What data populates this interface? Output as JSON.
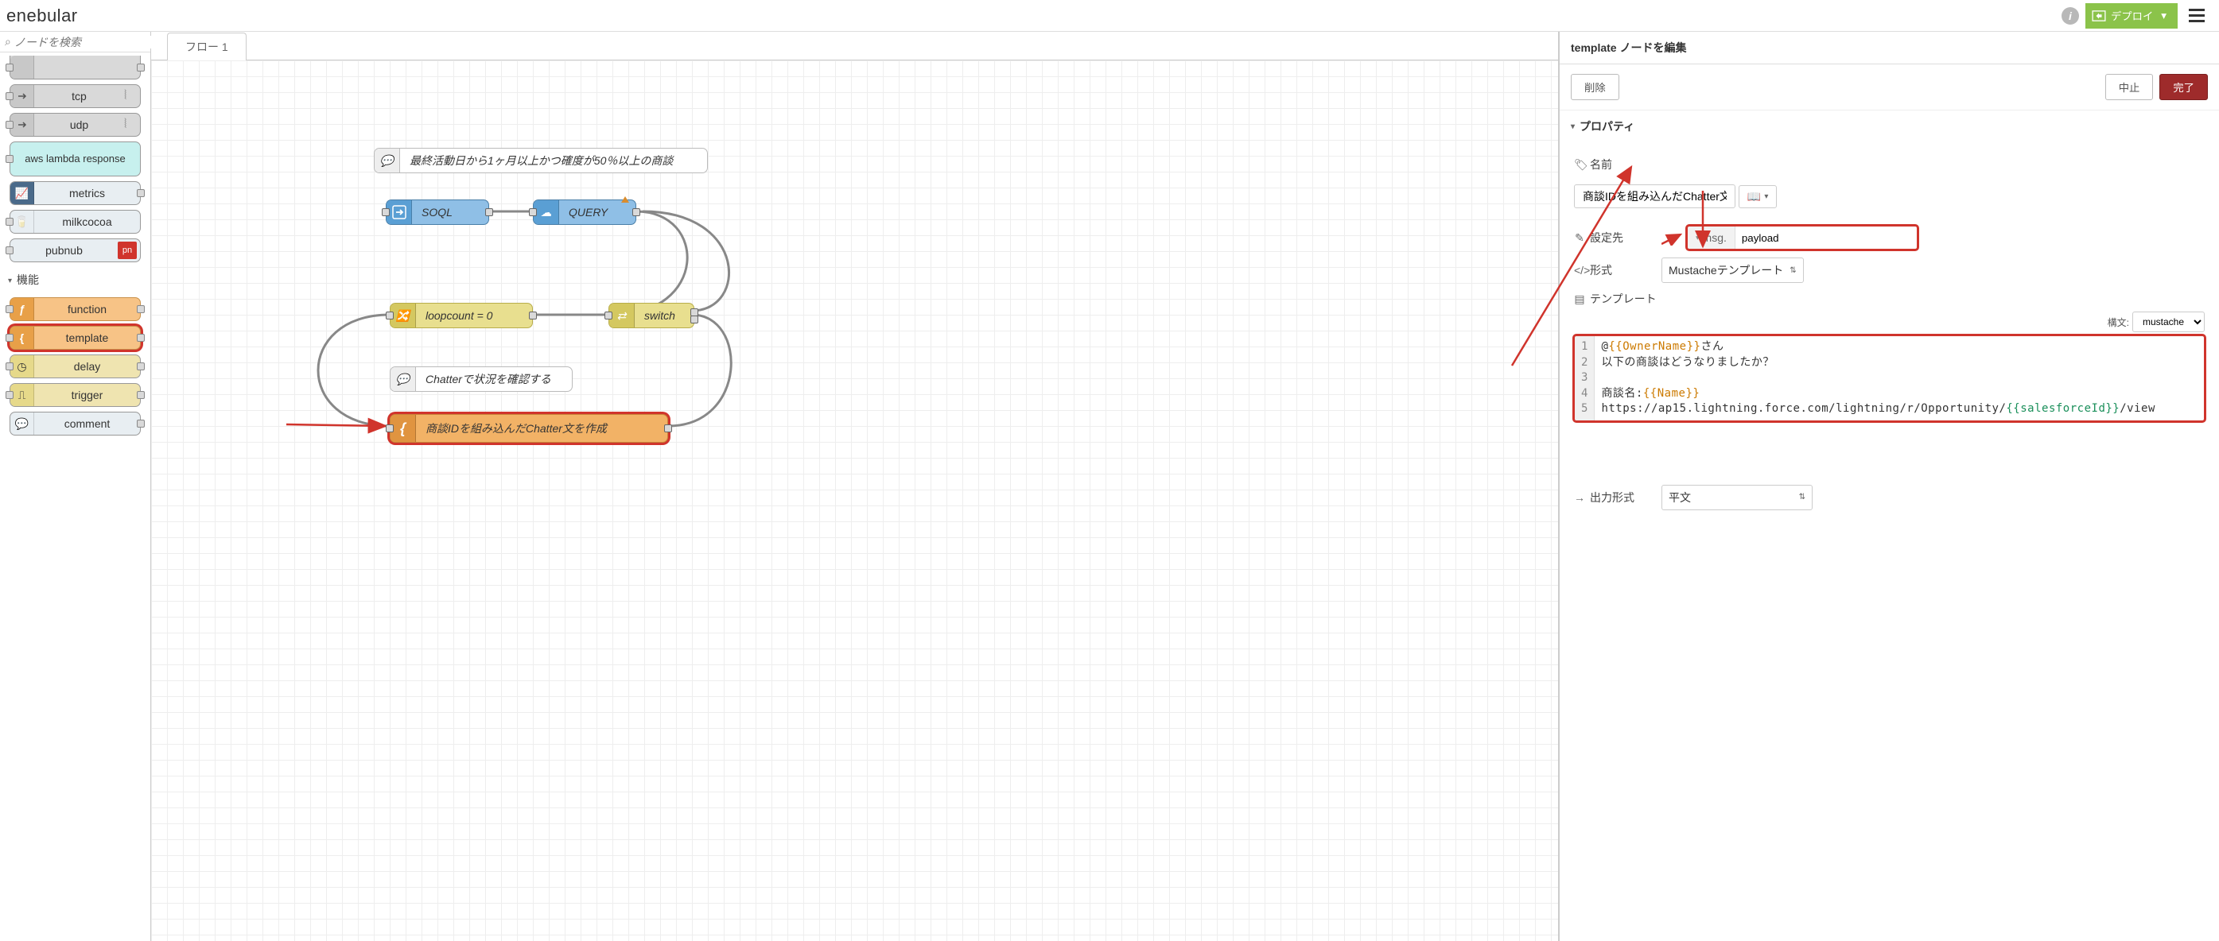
{
  "header": {
    "logo": "enebular",
    "deploy": "デプロイ"
  },
  "palette": {
    "search_placeholder": "ノードを検索",
    "items_top": [
      {
        "label": "tcp",
        "kind": "gray"
      },
      {
        "label": "udp",
        "kind": "gray"
      },
      {
        "label": "aws lambda response",
        "kind": "teal"
      },
      {
        "label": "metrics",
        "kind": "light"
      },
      {
        "label": "milkcocoa",
        "kind": "light"
      },
      {
        "label": "pubnub",
        "kind": "light",
        "badge": "pn"
      }
    ],
    "category": "機能",
    "items_fn": [
      {
        "label": "function",
        "kind": "orange"
      },
      {
        "label": "template",
        "kind": "orange",
        "hl": true
      },
      {
        "label": "delay",
        "kind": "sand"
      },
      {
        "label": "trigger",
        "kind": "sand"
      },
      {
        "label": "comment",
        "kind": "light"
      }
    ]
  },
  "workspace": {
    "tab": "フロー 1",
    "nodes": {
      "comment1": "最終活動日から1ヶ月以上かつ確度が50％以上の商談",
      "soql": "SOQL",
      "query": "QUERY",
      "loop": "loopcount = 0",
      "switch": "switch",
      "comment2": "Chatterで状況を確認する",
      "template": "商談IDを組み込んだChatter文を作成"
    }
  },
  "sidebar": {
    "title": "template ノードを編集",
    "delete": "削除",
    "cancel": "中止",
    "done": "完了",
    "section": "プロパティ",
    "name_label": "名前",
    "name_value": "商談IDを組み込んだChatter文を作成",
    "dest_label": "設定先",
    "dest_type": "msg.",
    "dest_value": "payload",
    "format_label": "形式",
    "format_value": "Mustacheテンプレート",
    "template_label": "テンプレート",
    "syntax_label": "構文:",
    "syntax_value": "mustache",
    "code": {
      "l1a": "@",
      "l1b": "{{OwnerName}}",
      "l1c": "さん",
      "l2": "以下の商談はどうなりましたか？",
      "l4a": "商談名:",
      "l4b": "{{Name}}",
      "l5a": "https://ap15.lightning.force.com/lightning/r/Opportunity/",
      "l5b": "{{salesforceId}}",
      "l5c": "/view"
    },
    "output_label": "出力形式",
    "output_value": "平文"
  }
}
